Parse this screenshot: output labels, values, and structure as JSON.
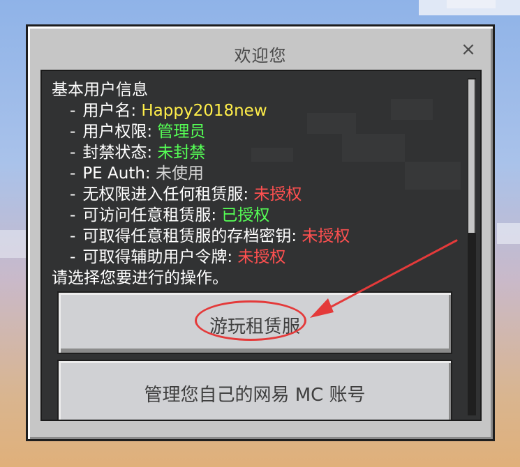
{
  "dialog": {
    "title": "欢迎您",
    "close_icon": "×"
  },
  "info": {
    "heading": "基本用户信息",
    "dash": "-",
    "items": [
      {
        "label": "用户名: ",
        "value": "Happy2018new",
        "color": "#ffee4a"
      },
      {
        "label": "用户权限: ",
        "value": "管理员",
        "color": "#55ff55"
      },
      {
        "label": "封禁状态: ",
        "value": "未封禁",
        "color": "#55ff55"
      },
      {
        "label": "PE Auth: ",
        "value": "未使用",
        "color": "#d4d4d4"
      },
      {
        "label": "无权限进入任何租赁服: ",
        "value": "未授权",
        "color": "#ff5050"
      },
      {
        "label": "可访问任意租赁服: ",
        "value": "已授权",
        "color": "#55ff55"
      },
      {
        "label": "可取得任意租赁服的存档密钥: ",
        "value": "未授权",
        "color": "#ff5050"
      },
      {
        "label": "可取得辅助用户令牌: ",
        "value": "未授权",
        "color": "#ff5050"
      }
    ],
    "prompt": "请选择您要进行的操作。"
  },
  "buttons": {
    "play_rental": "游玩租赁服",
    "manage_account": "管理您自己的网易 MC 账号"
  },
  "colors": {
    "annotation": "#e43a3a"
  }
}
